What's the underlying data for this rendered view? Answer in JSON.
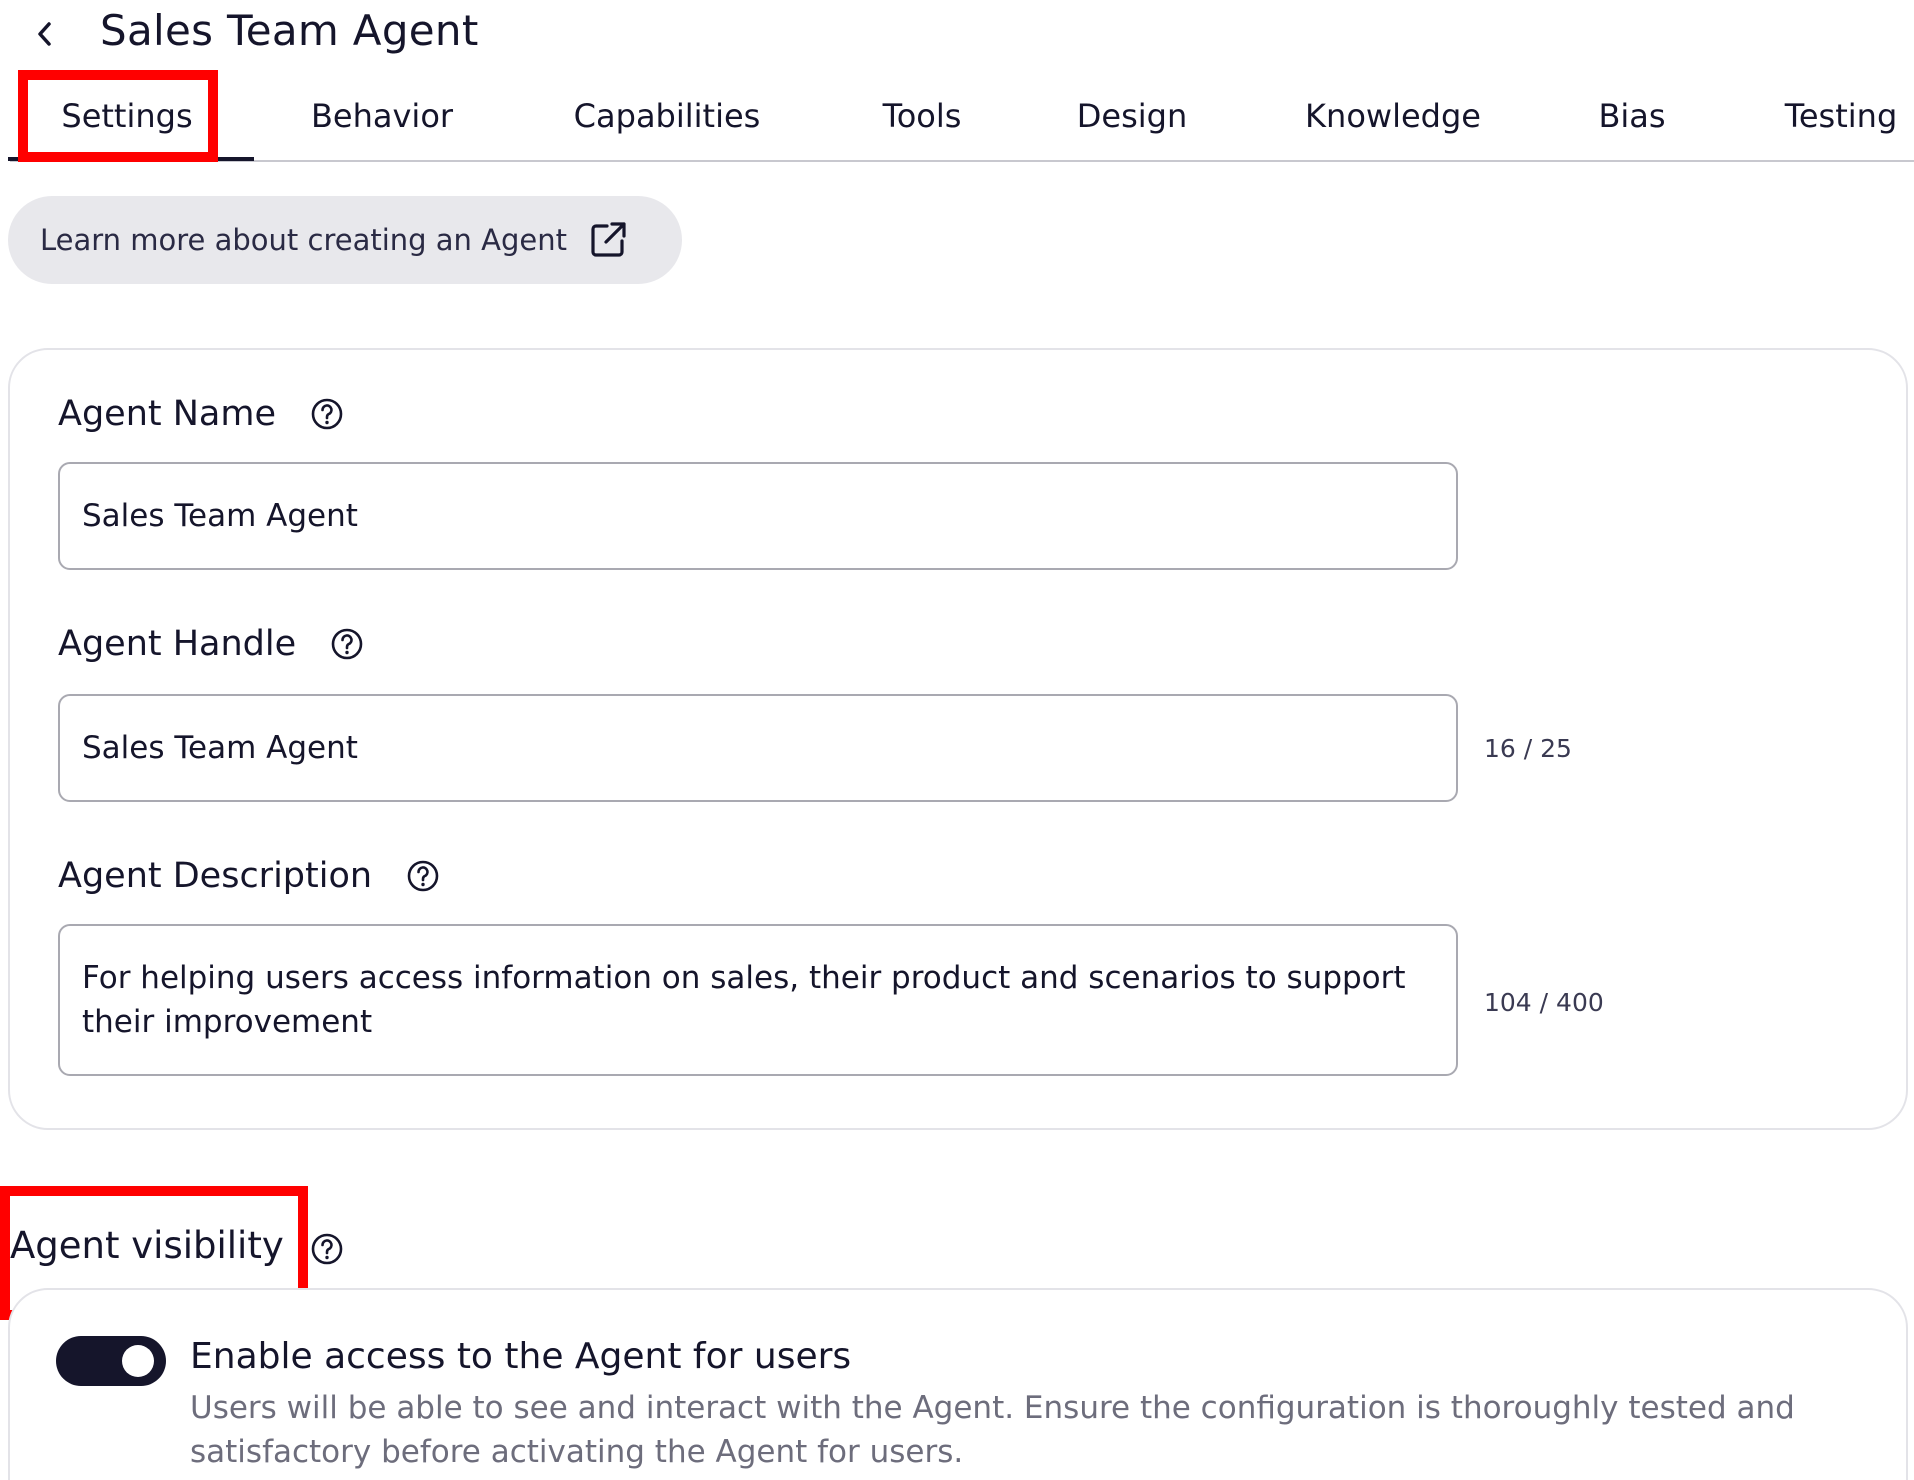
{
  "header": {
    "title": "Sales Team Agent"
  },
  "tabs": [
    {
      "label": "Settings"
    },
    {
      "label": "Behavior"
    },
    {
      "label": "Capabilities"
    },
    {
      "label": "Tools"
    },
    {
      "label": "Design"
    },
    {
      "label": "Knowledge"
    },
    {
      "label": "Bias"
    },
    {
      "label": "Testing"
    }
  ],
  "learn_more": {
    "label": "Learn more about creating an Agent",
    "icon": "external-link-icon"
  },
  "form": {
    "name": {
      "label": "Agent Name",
      "value": "Sales Team Agent"
    },
    "handle": {
      "label": "Agent Handle",
      "value": "Sales Team Agent",
      "counter": "16 / 25"
    },
    "description": {
      "label": "Agent Description",
      "value": "For helping users access information on sales, their product and scenarios to support their improvement",
      "counter": "104 / 400"
    }
  },
  "visibility": {
    "title": "Agent visibility",
    "toggle": {
      "label": "Enable access to the Agent for users",
      "description": "Users will be able to see and interact with the Agent. Ensure the configuration is thoroughly tested and satisfactory before activating the Agent for users.",
      "enabled": true
    }
  },
  "colors": {
    "primary": "#15152b",
    "highlight": "#ff0000",
    "pill_bg": "#e8e8ec",
    "muted_text": "#6d6d7c"
  }
}
